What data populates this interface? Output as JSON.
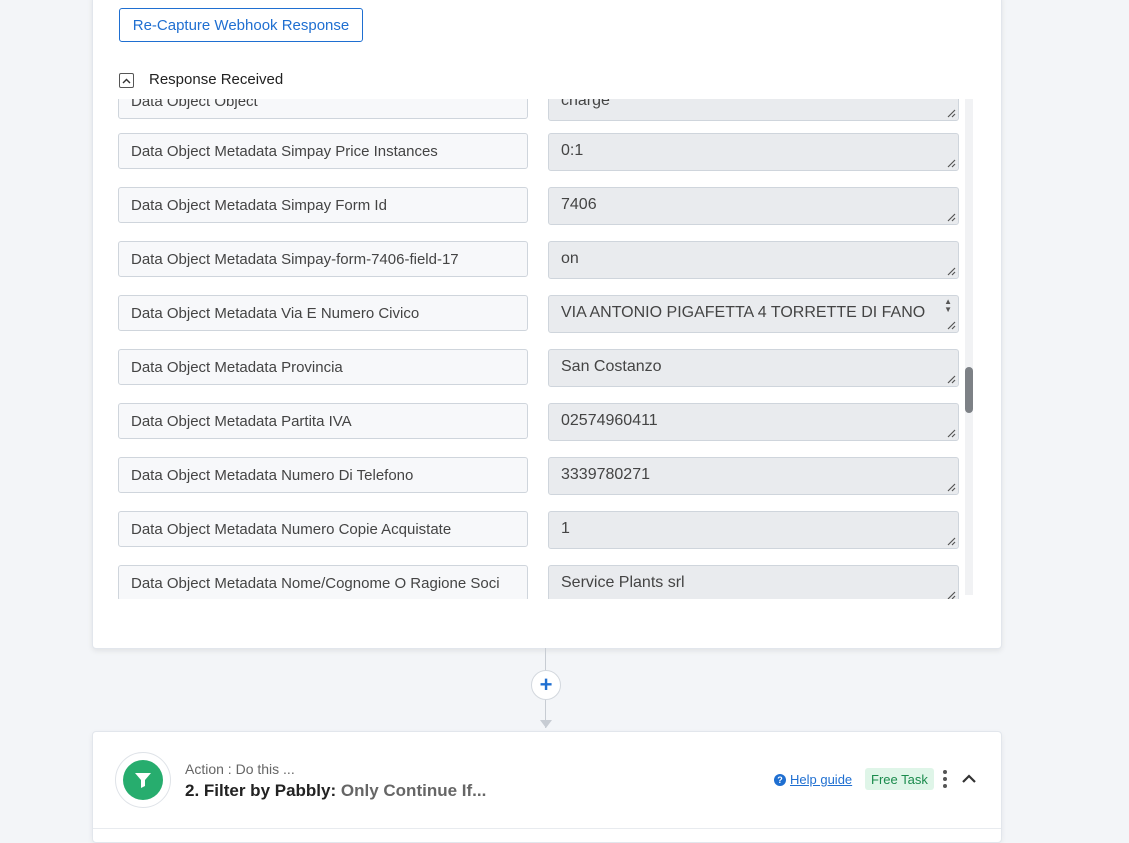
{
  "webhook_card": {
    "recapture_label": "Re-Capture Webhook Response",
    "response_label": "Response Received",
    "fields": [
      {
        "key": "Data Object Object",
        "value": "charge"
      },
      {
        "key": "Data Object Metadata Simpay Price Instances",
        "value": "0:1"
      },
      {
        "key": "Data Object Metadata Simpay Form Id",
        "value": "7406"
      },
      {
        "key": "Data Object Metadata Simpay-form-7406-field-17",
        "value": "on"
      },
      {
        "key": "Data Object Metadata Via E Numero Civico",
        "value": "VIA ANTONIO PIGAFETTA 4 TORRETTE DI FANO"
      },
      {
        "key": "Data Object Metadata Provincia",
        "value": "San Costanzo"
      },
      {
        "key": "Data Object Metadata Partita IVA",
        "value": "02574960411"
      },
      {
        "key": "Data Object Metadata Numero Di Telefono",
        "value": "3339780271"
      },
      {
        "key": "Data Object Metadata Numero Copie Acquistate",
        "value": "1"
      },
      {
        "key": "Data Object Metadata Nome/Cognome O Ragione Soci",
        "value": "Service Plants srl"
      }
    ]
  },
  "connector": {
    "add_symbol": "+"
  },
  "action_step": {
    "icon": "filter-icon",
    "subtitle": "Action : Do this ...",
    "title_app": "2. Filter by Pabbly:",
    "title_event": "Only Continue If...",
    "help_label": "Help guide",
    "badge": "Free Task",
    "accent_color": "#27ad6e"
  },
  "colors": {
    "primary": "#1f6fd1",
    "background": "#f3f5f8"
  }
}
